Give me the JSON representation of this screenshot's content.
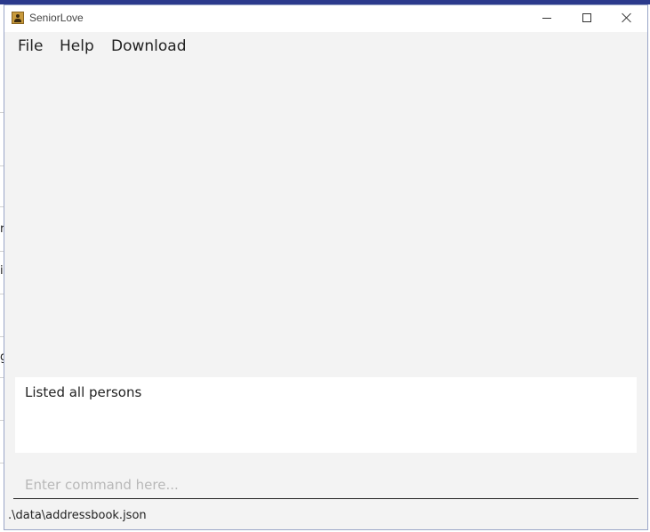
{
  "window": {
    "title": "SeniorLove"
  },
  "menu": {
    "file": "File",
    "help": "Help",
    "download": "Download"
  },
  "result_display": {
    "text": "Listed all persons"
  },
  "command_box": {
    "value": "",
    "placeholder": "Enter command here..."
  },
  "status_bar": {
    "save_location": ".\\data\\addressbook.json"
  },
  "background_app": {
    "partial_glyphs": [
      "r",
      "i",
      "g"
    ]
  },
  "colors": {
    "window_background": "#f3f3f3",
    "titlebar": "#ffffff",
    "desktop_accent": "#2b3a8c",
    "result_background": "#ffffff"
  }
}
